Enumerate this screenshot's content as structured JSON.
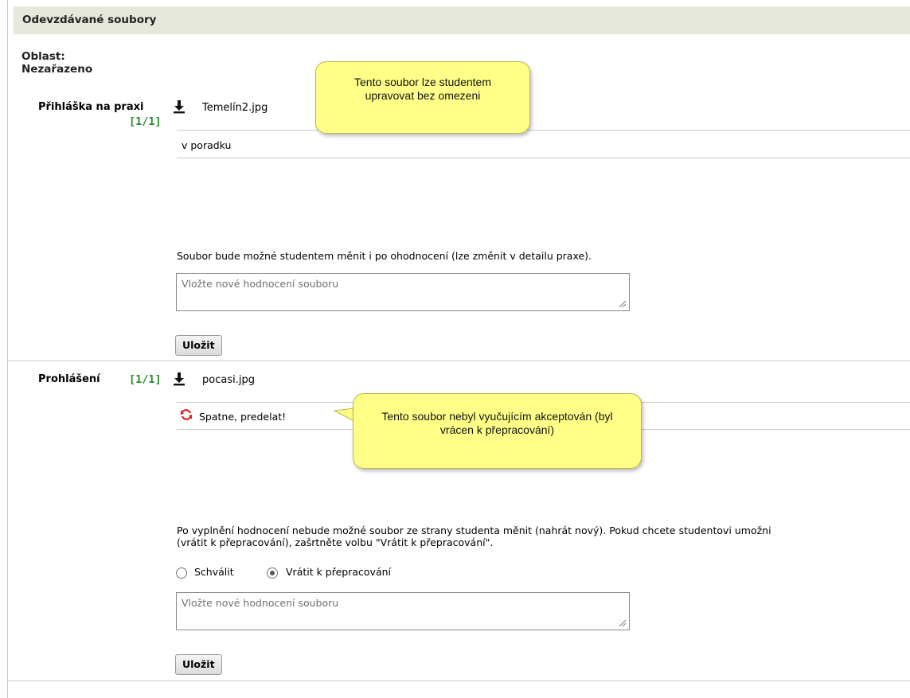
{
  "section": {
    "title": "Odevzdávané soubory"
  },
  "area": {
    "label": "Oblast:",
    "value": "Nezařazeno"
  },
  "files": [
    {
      "label": "Přihláška na praxi",
      "count": "[1/1]",
      "filename": "Temelín2.jpg",
      "comment": "v poradku",
      "tooltip": "Tento soubor lze studentem upravovat bez omezeni",
      "note": "Soubor bude možné studentem měnit i po ohodnocení (lze změnit v detailu praxe).",
      "textarea_placeholder": "Vložte nové hodnocení souboru",
      "save_label": "Uložit"
    },
    {
      "label": "Prohlášení",
      "count": "[1/1]",
      "filename": "pocasi.jpg",
      "comment": "Spatne, predelat!",
      "tooltip": "Tento soubor nebyl vyučujícím akceptován (byl vrácen k přepracování)",
      "note_line1": "Po vyplnění hodnocení nebude možné soubor ze strany studenta měnit (nahrát nový). Pokud chcete studentovi umožni",
      "note_line2": "(vrátit k přepracování), zašrtněte volbu \"Vrátit k přepracování\".",
      "radio_approve": "Schválit",
      "radio_return": "Vrátit k přepracování",
      "selected_option": "Vrátit k přepracování",
      "textarea_placeholder": "Vložte nové hodnocení souboru",
      "save_label": "Uložit"
    }
  ],
  "colors": {
    "count_green": "#2a8a2a",
    "tooltip_yellow": "#ffff88",
    "header_bg": "#e6e8dc",
    "return_icon_red": "#e02020"
  },
  "icons": [
    "download-icon",
    "refresh-icon",
    "resize-grip-icon"
  ]
}
